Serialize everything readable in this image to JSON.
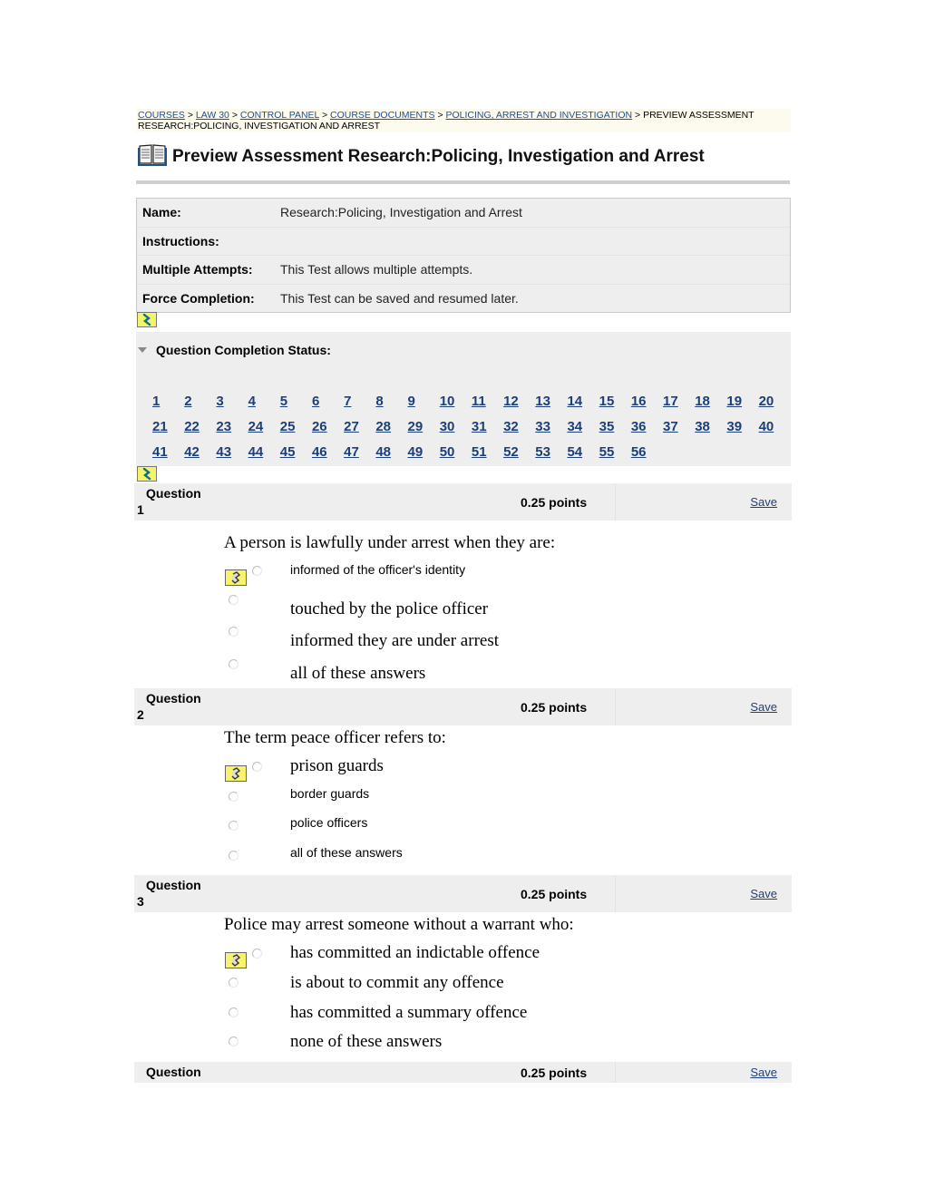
{
  "breadcrumb": {
    "links": [
      "COURSES",
      "LAW 30",
      "CONTROL PANEL",
      "COURSE DOCUMENTS",
      "POLICING, ARREST AND INVESTIGATION"
    ],
    "current": "PREVIEW ASSESSMENT RESEARCH:POLICING, INVESTIGATION AND ARREST",
    "separator": ">"
  },
  "page": {
    "icon": "book-icon",
    "title": "Preview Assessment Research:Policing, Investigation and Arrest"
  },
  "info": [
    {
      "label": "Name:",
      "value": "Research:Policing, Investigation and Arrest"
    },
    {
      "label": "Instructions:",
      "value": ""
    },
    {
      "label": "Multiple Attempts:",
      "value": "This Test allows multiple attempts."
    },
    {
      "label": "Force Completion:",
      "value": "This Test can be saved and resumed later."
    }
  ],
  "status": {
    "label": "Question Completion Status:",
    "numbers": [
      "1",
      "2",
      "3",
      "4",
      "5",
      "6",
      "7",
      "8",
      "9",
      "10",
      "11",
      "12",
      "13",
      "14",
      "15",
      "16",
      "17",
      "18",
      "19",
      "20",
      "21",
      "22",
      "23",
      "24",
      "25",
      "26",
      "27",
      "28",
      "29",
      "30",
      "31",
      "32",
      "33",
      "34",
      "35",
      "36",
      "37",
      "38",
      "39",
      "40",
      "41",
      "42",
      "43",
      "44",
      "45",
      "46",
      "47",
      "48",
      "49",
      "50",
      "51",
      "52",
      "53",
      "54",
      "55",
      "56"
    ]
  },
  "questions": [
    {
      "label": "Question",
      "number": "1",
      "points": "0.25 points",
      "save": "Save",
      "text": "A person is lawfully under arrest when they are:",
      "options": [
        {
          "text": "informed of the officer's identity",
          "style": "sans"
        },
        {
          "text": "touched by the police officer",
          "style": "serif"
        },
        {
          "text": "informed they are under arrest",
          "style": "serif"
        },
        {
          "text": "all of these answers",
          "style": "serif"
        }
      ]
    },
    {
      "label": "Question",
      "number": "2",
      "points": "0.25 points",
      "save": "Save",
      "text": "The term peace officer refers to:",
      "options": [
        {
          "text": "prison guards",
          "style": "serif"
        },
        {
          "text": "border guards",
          "style": "sans"
        },
        {
          "text": "police officers",
          "style": "sans"
        },
        {
          "text": "all of these answers",
          "style": "sans"
        }
      ]
    },
    {
      "label": "Question",
      "number": "3",
      "points": "0.25 points",
      "save": "Save",
      "text": "Police may arrest someone without a warrant who:",
      "options": [
        {
          "text": "has committed an indictable offence",
          "style": "serif"
        },
        {
          "text": "is about to commit any offence",
          "style": "serif"
        },
        {
          "text": "has committed a summary offence",
          "style": "serif"
        },
        {
          "text": "none of these answers",
          "style": "serif"
        }
      ]
    },
    {
      "label": "Question",
      "number": "",
      "points": "0.25 points",
      "save": "Save"
    }
  ]
}
